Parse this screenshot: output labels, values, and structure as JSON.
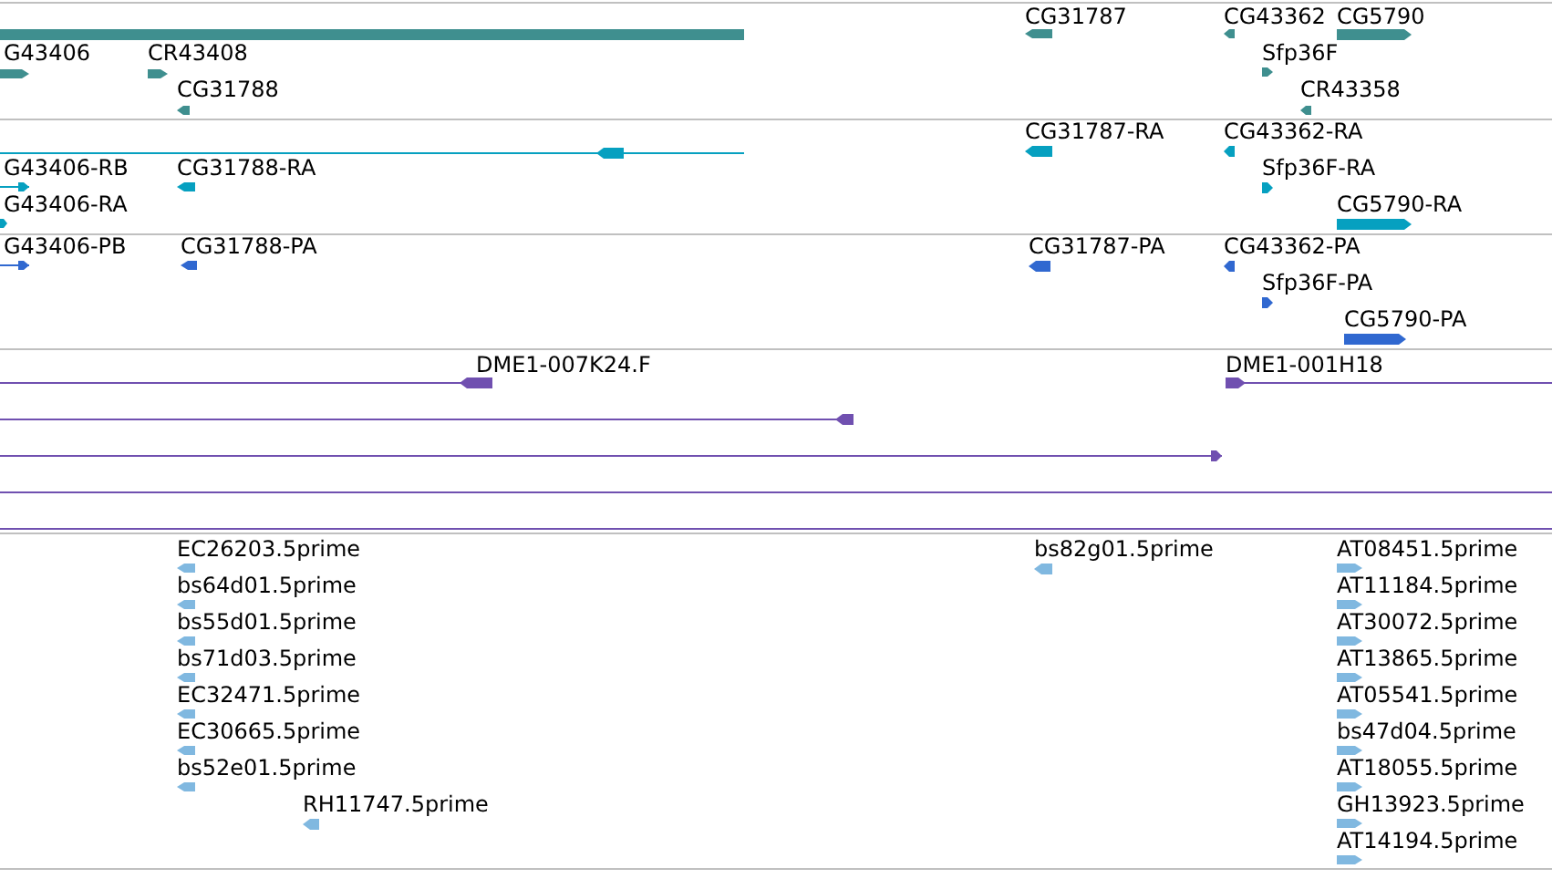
{
  "tracks": [
    {
      "color": "#3f8f8f",
      "features": [
        {
          "kind": "bar"
        },
        {
          "kind": "arrow",
          "label": "CG31787",
          "reverse": true
        },
        {
          "kind": "arrow",
          "label": "CG43362",
          "reverse": true
        },
        {
          "kind": "arrow",
          "label": "CG5790",
          "reverse": false
        },
        {
          "kind": "arrow",
          "label": "G43406",
          "reverse": false
        },
        {
          "kind": "arrow",
          "label": "CR43408",
          "reverse": false
        },
        {
          "kind": "arrow",
          "label": "Sfp36F",
          "reverse": false
        },
        {
          "kind": "arrow",
          "label": "CG31788",
          "reverse": true
        },
        {
          "kind": "arrow",
          "label": "CR43358",
          "reverse": true
        }
      ]
    },
    {
      "color": "#06a0c0",
      "features": [
        {
          "reverse": true
        },
        {
          "label": "CG31787-RA",
          "reverse": true
        },
        {
          "label": "CG43362-RA",
          "reverse": true
        },
        {
          "label": "G43406-RB",
          "reverse": false
        },
        {
          "label": "CG31788-RA",
          "reverse": true
        },
        {
          "label": "Sfp36F-RA",
          "reverse": false
        },
        {
          "label": "G43406-RA",
          "reverse": false
        },
        {
          "label": "CG5790-RA",
          "reverse": false
        }
      ]
    },
    {
      "color": "#3068d0",
      "features": [
        {
          "label": "G43406-PB",
          "reverse": false
        },
        {
          "label": "CG31788-PA",
          "reverse": true
        },
        {
          "label": "CG31787-PA",
          "reverse": true
        },
        {
          "label": "CG43362-PA",
          "reverse": true
        },
        {
          "label": "Sfp36F-PA",
          "reverse": false
        },
        {
          "label": "CG5790-PA",
          "reverse": false
        }
      ]
    },
    {
      "color": "#7050b0",
      "features": [
        {
          "kind": "arrow",
          "label": "DME1-007K24.F",
          "reverse": true
        },
        {
          "kind": "arrow",
          "label": "DME1-001H18",
          "reverse": false
        },
        {
          "kind": "arrow",
          "reverse": true
        },
        {
          "kind": "arrow",
          "reverse": false
        },
        {
          "kind": "line"
        },
        {
          "kind": "line"
        }
      ]
    },
    {
      "color": "#80b8e0",
      "features": [
        {
          "label": "EC26203.5prime",
          "reverse": true
        },
        {
          "label": "bs64d01.5prime",
          "reverse": true
        },
        {
          "label": "bs55d01.5prime",
          "reverse": true
        },
        {
          "label": "bs71d03.5prime",
          "reverse": true
        },
        {
          "label": "EC32471.5prime",
          "reverse": true
        },
        {
          "label": "EC30665.5prime",
          "reverse": true
        },
        {
          "label": "bs52e01.5prime",
          "reverse": true
        },
        {
          "label": "RH11747.5prime",
          "reverse": true
        },
        {
          "label": "bs82g01.5prime",
          "reverse": true
        },
        {
          "label": "AT08451.5prime",
          "reverse": false
        },
        {
          "label": "AT11184.5prime",
          "reverse": false
        },
        {
          "label": "AT30072.5prime",
          "reverse": false
        },
        {
          "label": "AT13865.5prime",
          "reverse": false
        },
        {
          "label": "AT05541.5prime",
          "reverse": false
        },
        {
          "label": "bs47d04.5prime",
          "reverse": false
        },
        {
          "label": "AT18055.5prime",
          "reverse": false
        },
        {
          "label": "GH13923.5prime",
          "reverse": false
        },
        {
          "label": "AT14194.5prime",
          "reverse": false
        }
      ]
    }
  ]
}
